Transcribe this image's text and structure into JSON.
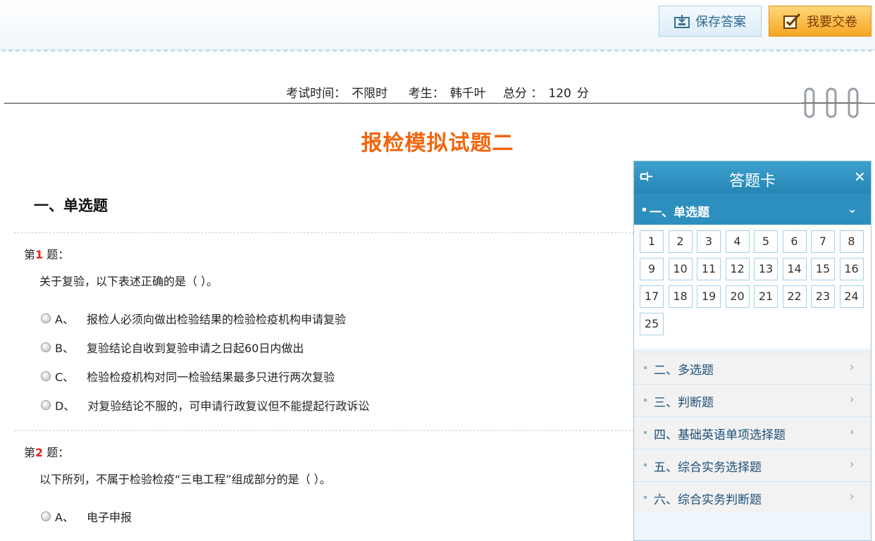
{
  "toolbar": {
    "save_label": "保存答案",
    "submit_label": "我要交卷",
    "save_icon": "save-icon",
    "submit_icon": "checkbox-pen-icon"
  },
  "exam_info": {
    "time_label": "考试时间：",
    "time_value": "不限时",
    "student_label": "考生：",
    "student_name": "韩千叶",
    "score_label": "总分 ：",
    "score_value": "120",
    "score_unit": "分"
  },
  "exam_title": "报检模拟试题二",
  "section": {
    "title": "一、单选题"
  },
  "questions": [
    {
      "num_prefix": "第",
      "num": "1",
      "num_suffix": "题：",
      "text": "关于复验，以下表述正确的是（   ）。",
      "options": [
        {
          "letter": "A、",
          "text": "报检人必须向做出检验结果的检验检疫机构申请复验"
        },
        {
          "letter": "B、",
          "text": "复验结论自收到复验申请之日起60日内做出"
        },
        {
          "letter": "C、",
          "text": "检验检疫机构对同一检验结果最多只进行两次复验"
        },
        {
          "letter": "D、",
          "text": "对复验结论不服的，可申请行政复议但不能提起行政诉讼"
        }
      ]
    },
    {
      "num_prefix": "第",
      "num": "2",
      "num_suffix": "题：",
      "text": "以下所列，不属于检验检疫“三电工程”组成部分的是（   ）。",
      "options": [
        {
          "letter": "A、",
          "text": "电子申报"
        }
      ]
    }
  ],
  "answer_card": {
    "title": "答题卡",
    "pin_icon": "pin-icon",
    "close_label": "✕",
    "active_section": "一、单选题",
    "active_chevron": "⌄",
    "numbers": [
      "1",
      "2",
      "3",
      "4",
      "5",
      "6",
      "7",
      "8",
      "9",
      "10",
      "11",
      "12",
      "13",
      "14",
      "15",
      "16",
      "17",
      "18",
      "19",
      "20",
      "21",
      "22",
      "23",
      "24",
      "25"
    ],
    "sections": [
      "二、多选题",
      "三、判断题",
      "四、基础英语单项选择题",
      "五、综合实务选择题",
      "六、综合实务判断题"
    ],
    "row_chevron": "›"
  },
  "colors": {
    "accent_orange": "#f2650c",
    "question_number_red": "#e8261b",
    "card_header_blue": "#2d8fbd"
  }
}
